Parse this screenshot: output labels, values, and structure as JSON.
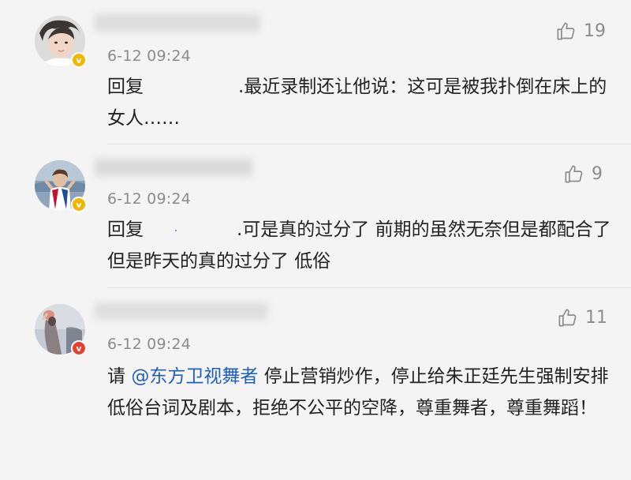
{
  "comments": [
    {
      "time": "6-12 09:24",
      "likes": "19",
      "avatar_icon": "user-avatar",
      "badge_icon": "verified-v-icon",
      "badge_color": "#f5b400",
      "reply_prefix": "回复",
      "text": ".最近录制还让他说：这可是被我扑倒在床上的女人……"
    },
    {
      "time": "6-12 09:24",
      "likes": "9",
      "avatar_icon": "user-avatar",
      "badge_icon": "verified-v-icon",
      "badge_color": "#f5b400",
      "reply_prefix": "回复",
      "text": ".可是真的过分了 前期的虽然无奈但是都配合了 但是昨天的真的过分了 低俗"
    },
    {
      "time": "6-12 09:24",
      "likes": "11",
      "avatar_icon": "user-avatar",
      "badge_icon": "verified-v-icon",
      "badge_color": "#e8402f",
      "text_prefix": "请 ",
      "mention": "@东方卫视舞者",
      "text": " 停止营销炒作，停止给朱正廷先生强制安排低俗台词及剧本，拒绝不公平的空降，尊重舞者，尊重舞蹈！"
    }
  ],
  "colors": {
    "background": "#f4f4f4",
    "meta_text": "#8c8c8c",
    "mention": "#1f5fbf"
  }
}
